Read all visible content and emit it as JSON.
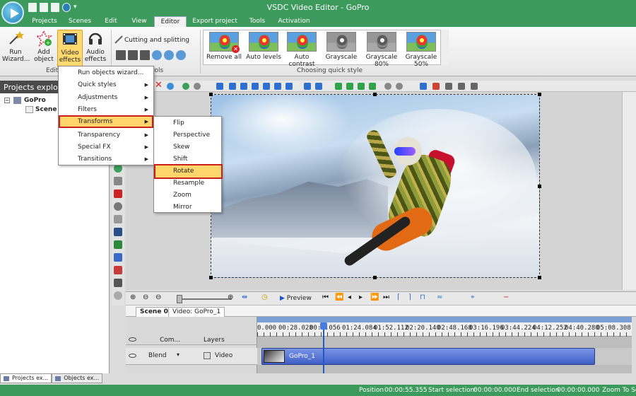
{
  "window": {
    "title": "VSDC Video Editor - GoPro"
  },
  "tabs": [
    "Projects",
    "Scenes",
    "Edit",
    "View",
    "Editor",
    "Export project",
    "Tools",
    "Activation"
  ],
  "active_tab": "Editor",
  "ribbon": {
    "run_wizard": "Run Wizard...",
    "add_object": "Add object",
    "video_effects": "Video effects",
    "audio_effects": "Audio effects",
    "cutting": "Cutting and splitting",
    "group_editing": "Editi",
    "group_tools": "ools",
    "group_quick": "Choosing quick style",
    "quick_styles": [
      "Remove all",
      "Auto levels",
      "Auto contrast",
      "Grayscale",
      "Grayscale 80%",
      "Grayscale 50%"
    ]
  },
  "left_panel": {
    "title": "Projects explor",
    "project": "GoPro",
    "scene": "Scene 0"
  },
  "video_effects_menu": [
    {
      "label": "Run objects wizard...",
      "sub": false
    },
    {
      "label": "Quick styles",
      "sub": true
    },
    {
      "label": "Adjustments",
      "sub": true
    },
    {
      "label": "Filters",
      "sub": true
    },
    {
      "label": "Transforms",
      "sub": true
    },
    {
      "label": "Transparency",
      "sub": true
    },
    {
      "label": "Special FX",
      "sub": true
    },
    {
      "label": "Transitions",
      "sub": true
    }
  ],
  "transforms_menu": [
    "Flip",
    "Perspective",
    "Skew",
    "Shift",
    "Rotate",
    "Resample",
    "Zoom",
    "Mirror"
  ],
  "timeline": {
    "preview_label": "Preview",
    "scene_tab": "Scene 0",
    "video_tab": "Video: GoPro_1",
    "ruler": [
      "0.000",
      "00:28.028",
      "00:",
      ".056",
      "01:24.084",
      "01:52.112",
      "02:20.140",
      "02:48.168",
      "03:16.196",
      "03:44.224",
      "04:12.252",
      "04:40.280",
      "05:08.308"
    ],
    "col_comp": "Com...",
    "col_layers": "Layers",
    "blend": "Blend",
    "video_label": "Video",
    "clip_label": "GoPro_1"
  },
  "bottom_tabs": [
    "Projects ex...",
    "Objects ex..."
  ],
  "status": {
    "position_label": "Position",
    "position": "00:00:55.355",
    "start_label": "Start selection:",
    "start": "00:00:00.000",
    "end_label": "End selection",
    "end": "00:00:00.000",
    "zoom": "Zoom To Scr"
  }
}
